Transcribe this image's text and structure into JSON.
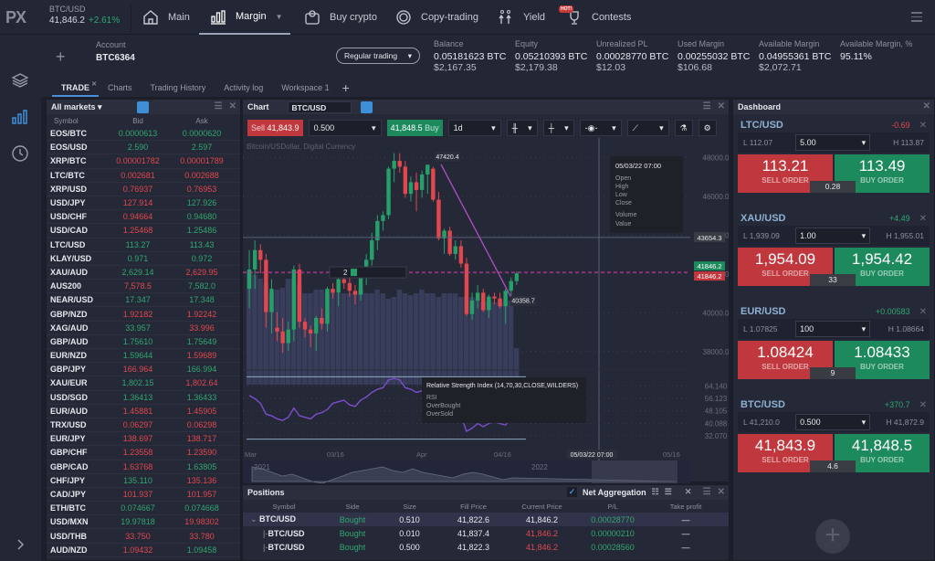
{
  "top": {
    "logo": "PX",
    "ticker": {
      "symbol": "BTC/USD",
      "price": "41,846.2",
      "change": "+2.61%"
    },
    "nav": [
      {
        "label": "Main",
        "icon": "home-icon"
      },
      {
        "label": "Margin",
        "icon": "bar-chart-icon",
        "active": true
      },
      {
        "label": "Buy crypto",
        "icon": "wallet-icon"
      },
      {
        "label": "Copy-trading",
        "icon": "copy-trading-icon"
      },
      {
        "label": "Yield",
        "icon": "yield-icon"
      },
      {
        "label": "Contests",
        "icon": "trophy-icon",
        "badge": "HOT!"
      }
    ]
  },
  "account": {
    "label": "Account",
    "value": "BTC6364",
    "mode": "Regular trading",
    "stats": [
      {
        "label": "Balance",
        "v1": "0.05181623 BTC",
        "v2": "$2,167.35"
      },
      {
        "label": "Equity",
        "v1": "0.05210393 BTC",
        "v2": "$2,179.38"
      },
      {
        "label": "Unrealized PL",
        "v1": "0.00028770 BTC",
        "v2": "$12.03",
        "color": "green"
      },
      {
        "label": "Used Margin",
        "v1": "0.00255032 BTC",
        "v2": "$106.68"
      },
      {
        "label": "Available Margin",
        "v1": "0.04955361 BTC",
        "v2": "$2,072.71"
      },
      {
        "label": "Available Margin, %",
        "v1": "95.11%",
        "v2": "",
        "color": "green"
      }
    ]
  },
  "tabs": [
    {
      "label": "TRADE",
      "active": true
    },
    {
      "label": "Charts"
    },
    {
      "label": "Trading History"
    },
    {
      "label": "Activity log"
    },
    {
      "label": "Workspace 1"
    }
  ],
  "markets": {
    "title": "All markets",
    "columns": [
      "Symbol",
      "Bid",
      "Ask"
    ],
    "rows": [
      [
        "EOS/BTC",
        "0.0000613",
        "g",
        "0.0000620",
        "g"
      ],
      [
        "EOS/USD",
        "2.590",
        "g",
        "2.597",
        "g"
      ],
      [
        "XRP/BTC",
        "0.00001782",
        "r",
        "0.00001789",
        "r"
      ],
      [
        "LTC/BTC",
        "0.002681",
        "r",
        "0.002688",
        "r"
      ],
      [
        "XRP/USD",
        "0.76937",
        "r",
        "0.76953",
        "r"
      ],
      [
        "USD/JPY",
        "127.914",
        "r",
        "127.926",
        "g"
      ],
      [
        "USD/CHF",
        "0.94664",
        "r",
        "0.94680",
        "g"
      ],
      [
        "USD/CAD",
        "1.25468",
        "r",
        "1.25486",
        "g"
      ],
      [
        "LTC/USD",
        "113.27",
        "g",
        "113.43",
        "g"
      ],
      [
        "KLAY/USD",
        "0.971",
        "g",
        "0.972",
        "g"
      ],
      [
        "XAU/AUD",
        "2,629.14",
        "g",
        "2,629.95",
        "r"
      ],
      [
        "AUS200",
        "7,578.5",
        "r",
        "7,582.0",
        "g"
      ],
      [
        "NEAR/USD",
        "17.347",
        "g",
        "17.348",
        "g"
      ],
      [
        "GBP/NZD",
        "1.92182",
        "r",
        "1.92242",
        "r"
      ],
      [
        "XAG/AUD",
        "33.957",
        "g",
        "33.996",
        "r"
      ],
      [
        "GBP/AUD",
        "1.75610",
        "g",
        "1.75649",
        "g"
      ],
      [
        "EUR/NZD",
        "1.59644",
        "g",
        "1.59689",
        "r"
      ],
      [
        "GBP/JPY",
        "166.964",
        "r",
        "166.994",
        "g"
      ],
      [
        "XAU/EUR",
        "1,802.15",
        "g",
        "1,802.64",
        "r"
      ],
      [
        "USD/SGD",
        "1.36413",
        "g",
        "1.36433",
        "g"
      ],
      [
        "EUR/AUD",
        "1.45881",
        "r",
        "1.45905",
        "r"
      ],
      [
        "TRX/USD",
        "0.06297",
        "r",
        "0.06298",
        "r"
      ],
      [
        "EUR/JPY",
        "138.697",
        "r",
        "138.717",
        "r"
      ],
      [
        "GBP/CHF",
        "1.23558",
        "r",
        "1.23590",
        "r"
      ],
      [
        "GBP/CAD",
        "1.63768",
        "r",
        "1.63805",
        "g"
      ],
      [
        "CHF/JPY",
        "135.110",
        "g",
        "135.136",
        "r"
      ],
      [
        "CAD/JPY",
        "101.937",
        "r",
        "101.957",
        "r"
      ],
      [
        "ETH/BTC",
        "0.074667",
        "g",
        "0.074668",
        "g"
      ],
      [
        "USD/MXN",
        "19.97818",
        "g",
        "19.98302",
        "r"
      ],
      [
        "USD/THB",
        "33.750",
        "r",
        "33.780",
        "r"
      ],
      [
        "AUD/NZD",
        "1.09432",
        "r",
        "1.09458",
        "g"
      ]
    ]
  },
  "chart": {
    "title": "Chart",
    "symbol": "BTC/USD",
    "sell_label": "Sell",
    "sell_price": "41,843.9",
    "amount": "0.500",
    "buy_price": "41,848.5",
    "buy_label": "Buy",
    "interval": "1d",
    "series_name": "Bitcoin/USDollar, Digital Currency",
    "price_axis": [
      "48000.0",
      "46000.0",
      "44000.0",
      "42000.0",
      "40000.0",
      "38000.0"
    ],
    "crosshair_price": "43654.3",
    "last_bid": "41846.2",
    "last_ask": "41846.2",
    "high_label": "47420.4",
    "low_label": "40358.7",
    "tooltip": {
      "date": "05/03/22 07:00",
      "fields": [
        "Open",
        "High",
        "Low",
        "Close"
      ],
      "fields2": [
        "Volume",
        "Value"
      ]
    },
    "nav_count": "2",
    "rsi": {
      "title": "Relative Strength Index (14,70,30,CLOSE,WILDERS)",
      "fields": [
        "RSI",
        "OverBought",
        "OverSold"
      ],
      "axis": [
        "64.140",
        "56.123",
        "48.105",
        "40.088",
        "32.070"
      ]
    },
    "time_axis": [
      "Mar",
      "03/16",
      "Apr",
      "04/16",
      "05/16"
    ],
    "crosshair_date": "05/03/22 07:00",
    "overview_years": [
      "2021",
      "2022"
    ],
    "candles": [
      [
        41,
        43,
        40,
        42
      ],
      [
        42,
        43.5,
        41,
        43
      ],
      [
        43,
        43.3,
        41.8,
        42.5
      ],
      [
        42.5,
        42.8,
        39,
        39.8
      ],
      [
        39.8,
        41.5,
        38.7,
        41
      ],
      [
        39,
        39.8,
        38.3,
        38.8
      ],
      [
        38.8,
        39.5,
        37.7,
        38.2
      ],
      [
        38.2,
        39.3,
        37.8,
        38.9
      ],
      [
        38.9,
        42.2,
        38.3,
        42
      ],
      [
        42,
        42.3,
        39,
        39.3
      ],
      [
        39.3,
        39.5,
        38.5,
        38.9
      ],
      [
        38.9,
        39.1,
        38,
        38.7
      ],
      [
        38.7,
        39.6,
        37.8,
        39.5
      ],
      [
        39.5,
        40,
        38.9,
        39.2
      ],
      [
        39.2,
        41.1,
        38.8,
        41
      ],
      [
        41,
        41.3,
        40.5,
        40.8
      ],
      [
        40.8,
        41.6,
        40.1,
        41.5
      ],
      [
        41.5,
        41.8,
        41,
        41.3
      ],
      [
        41.3,
        41.7,
        40.6,
        40.9
      ],
      [
        40.9,
        41.2,
        40.2,
        40.7
      ],
      [
        40.7,
        41.8,
        40.4,
        41.6
      ],
      [
        41.6,
        42.8,
        41.2,
        42.5
      ],
      [
        42.5,
        43.9,
        42.2,
        43.5
      ],
      [
        43.5,
        44.8,
        43,
        44.5
      ],
      [
        44.5,
        45,
        44,
        44.8
      ],
      [
        44.8,
        47.3,
        44.6,
        47.2
      ],
      [
        47.2,
        48,
        46.5,
        47.6
      ],
      [
        47.6,
        48,
        47,
        47.3
      ],
      [
        47.3,
        47.6,
        45.7,
        45.9
      ],
      [
        45.9,
        46.8,
        45.5,
        46.5
      ],
      [
        46.5,
        47,
        45,
        46.1
      ],
      [
        46.1,
        47.1,
        45.7,
        46.9
      ],
      [
        46.9,
        47.4,
        45.9,
        47.4
      ],
      [
        47.2,
        47.3,
        45.5,
        45.6
      ],
      [
        45.6,
        46,
        43.5,
        43.6
      ],
      [
        43.6,
        44.1,
        42.8,
        44
      ],
      [
        44,
        44.2,
        42.7,
        42.8
      ],
      [
        42.8,
        43.5,
        42.5,
        43.2
      ],
      [
        43.2,
        43.5,
        42.1,
        42.3
      ],
      [
        42.3,
        42.6,
        39.6,
        39.7
      ],
      [
        39.7,
        40.8,
        39.4,
        40.4
      ],
      [
        40.4,
        41.2,
        40,
        40.8
      ],
      [
        40.8,
        41,
        39.8,
        39.9
      ],
      [
        39.9,
        40.7,
        39.5,
        40.6
      ],
      [
        40.6,
        40.8,
        40.2,
        40.5
      ],
      [
        40.5,
        40.8,
        40,
        40.1
      ],
      [
        40.1,
        41,
        39.2,
        40.9
      ],
      [
        40.9,
        41.6,
        40.5,
        41.4
      ],
      [
        41.4,
        41.9,
        41.2,
        41.8
      ]
    ],
    "volumes": [
      0.62,
      0.6,
      0.58,
      0.55,
      0.5,
      0.52,
      0.53,
      0.58,
      0.58,
      0.55,
      0.5,
      0.5,
      0.52,
      0.52,
      0.5,
      0.52,
      0.5,
      0.5,
      0.5,
      0.5,
      0.52,
      0.5,
      0.5,
      0.52,
      0.5,
      0.47,
      0.48,
      0.52,
      0.5,
      0.49,
      0.5,
      0.52,
      0.5,
      0.5,
      0.48,
      0.5,
      0.5,
      0.5,
      0.48,
      0.48,
      0.48,
      0.47,
      0.45,
      0.46,
      0.45,
      0.45,
      0.46,
      0.46,
      0.2
    ],
    "rsi_values": [
      58,
      56,
      53,
      46,
      45,
      43,
      42,
      44,
      50,
      45,
      44,
      43,
      46,
      47,
      49,
      53,
      54,
      55,
      52,
      51,
      55,
      57,
      60,
      62,
      63,
      68,
      69,
      68,
      63,
      62,
      60,
      61,
      59,
      55,
      52,
      50,
      49,
      47,
      45,
      35,
      37,
      40,
      38,
      40,
      41,
      40,
      39,
      44,
      48
    ]
  },
  "positions": {
    "title": "Positions",
    "net_label": "Net Aggregation",
    "columns": [
      "Symbol",
      "Side",
      "Size",
      "Fill Price",
      "Current Price",
      "P/L",
      "Take profit"
    ],
    "rows": [
      {
        "symbol": "BTC/USD",
        "side": "Bought",
        "size": "0.510",
        "fill": "41,822.6",
        "current": "41,846.2",
        "cur_color": "white",
        "pl": "0.00028770",
        "tp": "—",
        "group": true
      },
      {
        "symbol": "BTC/USD",
        "side": "Bought",
        "size": "0.010",
        "fill": "41,837.4",
        "current": "41,846.2",
        "cur_color": "red",
        "pl": "0.00000210",
        "tp": "—"
      },
      {
        "symbol": "BTC/USD",
        "side": "Bought",
        "size": "0.500",
        "fill": "41,822.3",
        "current": "41,846.2",
        "cur_color": "red",
        "pl": "0.00028560",
        "tp": "—"
      }
    ]
  },
  "dashboard": {
    "title": "Dashboard",
    "sell_label": "SELL ORDER",
    "buy_label": "BUY ORDER",
    "cards": [
      {
        "pair": "LTC/USD",
        "change": "-0.69",
        "dir": "down",
        "low": "L 112.07",
        "amount": "5.00",
        "high": "H 113.87",
        "sell": "113.21",
        "buy": "113.49",
        "spread": "0.28"
      },
      {
        "pair": "XAU/USD",
        "change": "+4.49",
        "dir": "up",
        "low": "L 1,939.09",
        "amount": "1.00",
        "high": "H 1,955.01",
        "sell": "1,954.09",
        "buy": "1,954.42",
        "spread": "33"
      },
      {
        "pair": "EUR/USD",
        "change": "+0.00583",
        "dir": "up",
        "low": "L 1.07825",
        "amount": "100",
        "high": "H 1.08664",
        "sell": "1.08424",
        "buy": "1.08433",
        "spread": "9"
      },
      {
        "pair": "BTC/USD",
        "change": "+370.7",
        "dir": "up",
        "low": "L 41,210.0",
        "amount": "0.500",
        "high": "H 41,872.9",
        "sell": "41,843.9",
        "buy": "41,848.5",
        "spread": "4.6"
      }
    ]
  }
}
